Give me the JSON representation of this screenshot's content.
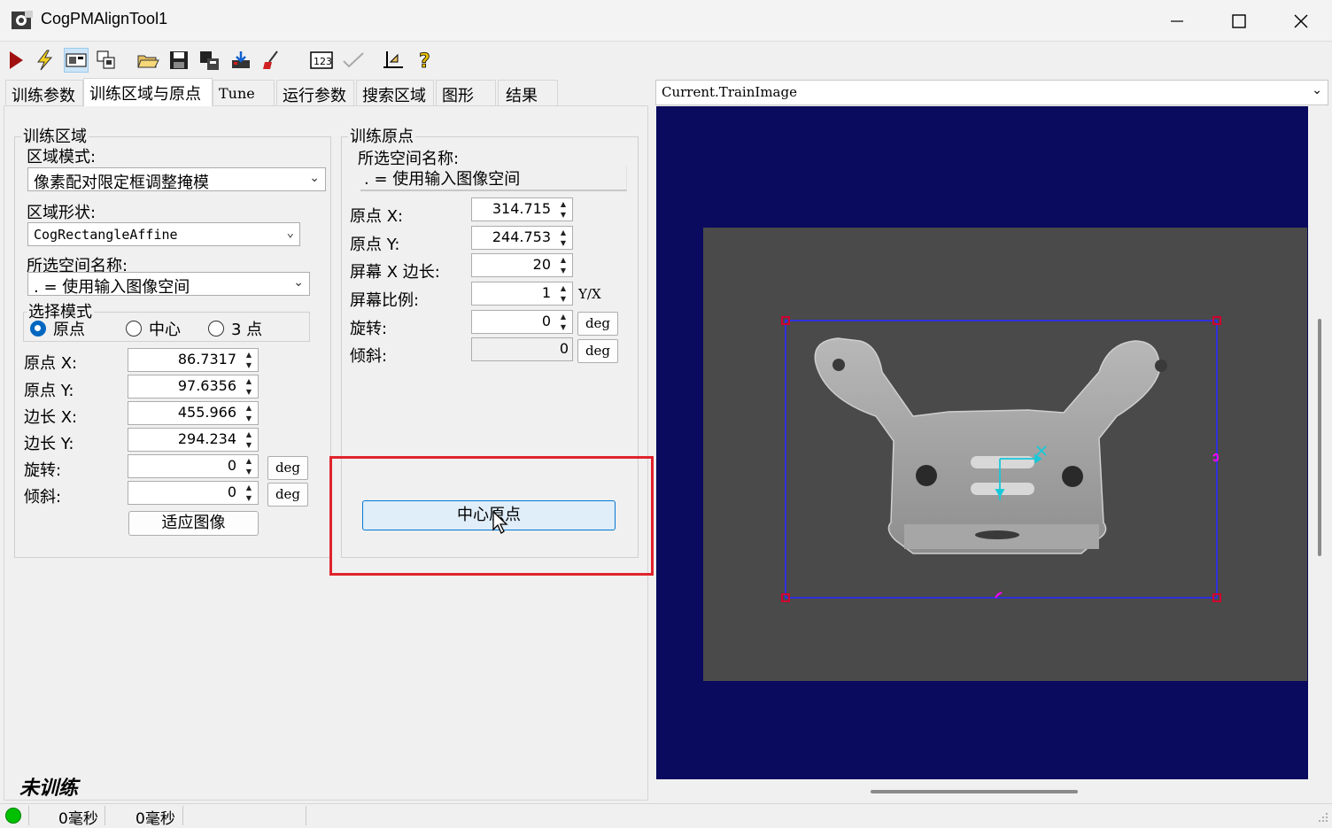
{
  "window": {
    "title": "CogPMAlignTool1"
  },
  "tabs": [
    {
      "label": "训练参数"
    },
    {
      "label": "训练区域与原点"
    },
    {
      "label": "Tune"
    },
    {
      "label": "运行参数"
    },
    {
      "label": "搜索区域"
    },
    {
      "label": "图形"
    },
    {
      "label": "结果"
    }
  ],
  "train_region": {
    "group_title": "训练区域",
    "region_mode_label": "区域模式:",
    "region_mode_value": "像素配对限定框调整掩模",
    "region_shape_label": "区域形状:",
    "region_shape_value": "CogRectangleAffine",
    "space_label": "所选空间名称:",
    "space_value": ". = 使用输入图像空间",
    "select_mode_title": "选择模式",
    "radio_origin": "原点",
    "radio_center": "中心",
    "radio_3pt": "3 点",
    "origin_x_label": "原点 X:",
    "origin_x": "86.7317",
    "origin_y_label": "原点 Y:",
    "origin_y": "97.6356",
    "side_x_label": "边长 X:",
    "side_x": "455.966",
    "side_y_label": "边长 Y:",
    "side_y": "294.234",
    "rotation_label": "旋转:",
    "rotation": "0",
    "skew_label": "倾斜:",
    "skew": "0",
    "deg": "deg",
    "fit_image_button": "适应图像"
  },
  "train_origin": {
    "group_title": "训练原点",
    "space_label": "所选空间名称:",
    "space_value": ". = 使用输入图像空间",
    "origin_x_label": "原点 X:",
    "origin_x": "314.715",
    "origin_y_label": "原点 Y:",
    "origin_y": "244.753",
    "screen_x_label": "屏幕 X 边长:",
    "screen_x": "20",
    "screen_ratio_label": "屏幕比例:",
    "screen_ratio": "1",
    "ratio_unit": "Y/X",
    "rotation_label": "旋转:",
    "rotation": "0",
    "skew_label": "倾斜:",
    "skew": "0",
    "deg": "deg",
    "center_origin_button": "中心原点"
  },
  "image_selector": {
    "value": "Current.TrainImage"
  },
  "status": {
    "train_state": "未训练",
    "time1": "0毫秒",
    "time2": "0毫秒"
  },
  "colors": {
    "display_bg": "#0a0a5e",
    "highlight_red": "#e0242c",
    "roi_blue": "#2b2bff",
    "status_green": "#00c000"
  }
}
